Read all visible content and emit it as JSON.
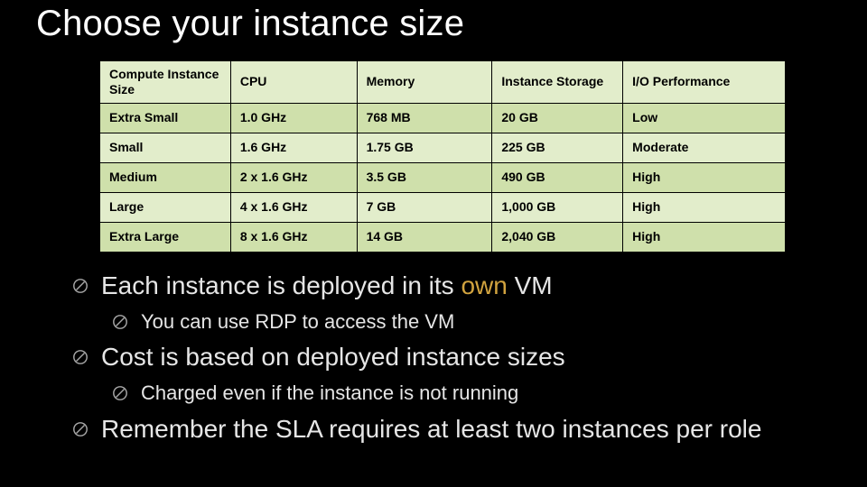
{
  "title": "Choose your instance size",
  "table": {
    "headers": [
      "Compute Instance Size",
      "CPU",
      "Memory",
      "Instance Storage",
      "I/O Performance"
    ],
    "rows": [
      [
        "Extra Small",
        "1.0 GHz",
        "768 MB",
        "20 GB",
        "Low"
      ],
      [
        "Small",
        "1.6 GHz",
        "1.75 GB",
        "225 GB",
        "Moderate"
      ],
      [
        "Medium",
        "2 x 1.6 GHz",
        "3.5 GB",
        "490 GB",
        "High"
      ],
      [
        "Large",
        "4 x 1.6 GHz",
        "7 GB",
        "1,000 GB",
        "High"
      ],
      [
        "Extra Large",
        "8 x 1.6 GHz",
        "14 GB",
        "2,040 GB",
        "High"
      ]
    ]
  },
  "bullets": {
    "b1_a": "Each instance is deployed in its ",
    "b1_hl": "own",
    "b1_b": " VM",
    "b1_sub": "You can use RDP to access the VM",
    "b2": "Cost is based on deployed instance sizes",
    "b2_sub": "Charged even if the instance is not running",
    "b3": "Remember the SLA requires at least two instances per role"
  },
  "chart_data": {
    "type": "table",
    "title": "Choose your instance size",
    "columns": [
      "Compute Instance Size",
      "CPU",
      "Memory",
      "Instance Storage",
      "I/O Performance"
    ],
    "rows": [
      {
        "Compute Instance Size": "Extra Small",
        "CPU": "1.0 GHz",
        "Memory": "768 MB",
        "Instance Storage": "20 GB",
        "I/O Performance": "Low"
      },
      {
        "Compute Instance Size": "Small",
        "CPU": "1.6 GHz",
        "Memory": "1.75 GB",
        "Instance Storage": "225 GB",
        "I/O Performance": "Moderate"
      },
      {
        "Compute Instance Size": "Medium",
        "CPU": "2 x 1.6 GHz",
        "Memory": "3.5 GB",
        "Instance Storage": "490 GB",
        "I/O Performance": "High"
      },
      {
        "Compute Instance Size": "Large",
        "CPU": "4 x 1.6 GHz",
        "Memory": "7 GB",
        "Instance Storage": "1,000 GB",
        "I/O Performance": "High"
      },
      {
        "Compute Instance Size": "Extra Large",
        "CPU": "8 x 1.6 GHz",
        "Memory": "14 GB",
        "Instance Storage": "2,040 GB",
        "I/O Performance": "High"
      }
    ]
  }
}
